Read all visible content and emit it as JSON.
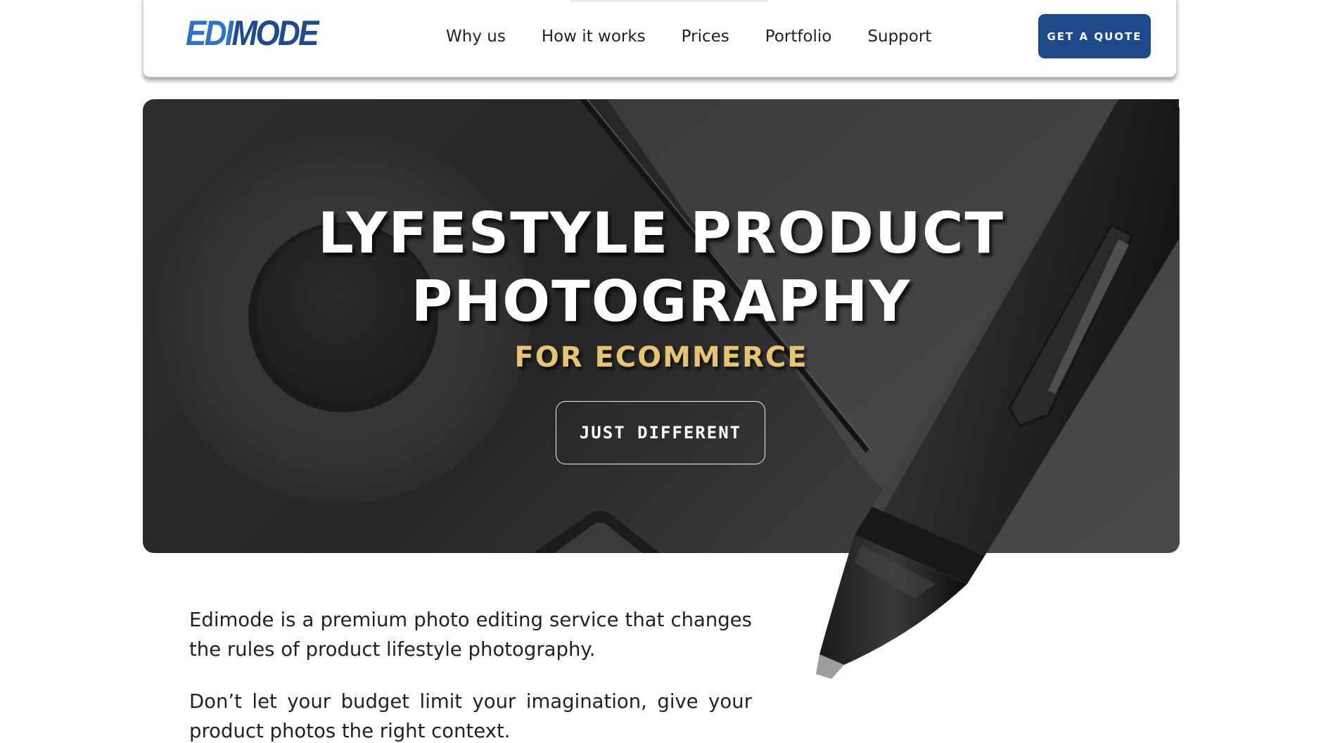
{
  "header": {
    "logo_text": "EDIMODE",
    "logo_part1": "EDI",
    "logo_part2": "MODE",
    "nav": [
      {
        "label": "Why us"
      },
      {
        "label": "How it works"
      },
      {
        "label": "Prices"
      },
      {
        "label": "Portfolio"
      },
      {
        "label": "Support"
      }
    ],
    "cta_label": "GET A QUOTE"
  },
  "hero": {
    "title_line1": "LYFESTYLE PRODUCT",
    "title_line2": "PHOTOGRAPHY",
    "subtitle": "FOR ECOMMERCE",
    "button_label": "JUST DIFFERENT"
  },
  "intro": {
    "paragraph1": "Edimode is a premium photo editing service that changes the rules of product lifestyle photography.",
    "paragraph2": "Don’t let your budget limit your imagination, give your product photos the right context."
  },
  "colors": {
    "brand_primary": "#1e4a8c",
    "brand_light": "#2e74c0",
    "accent_gold": "#e6c470",
    "hero_background": "#2d2d2f"
  },
  "icons": {
    "hero_image": "stylus-pen-on-graphics-tablet"
  }
}
